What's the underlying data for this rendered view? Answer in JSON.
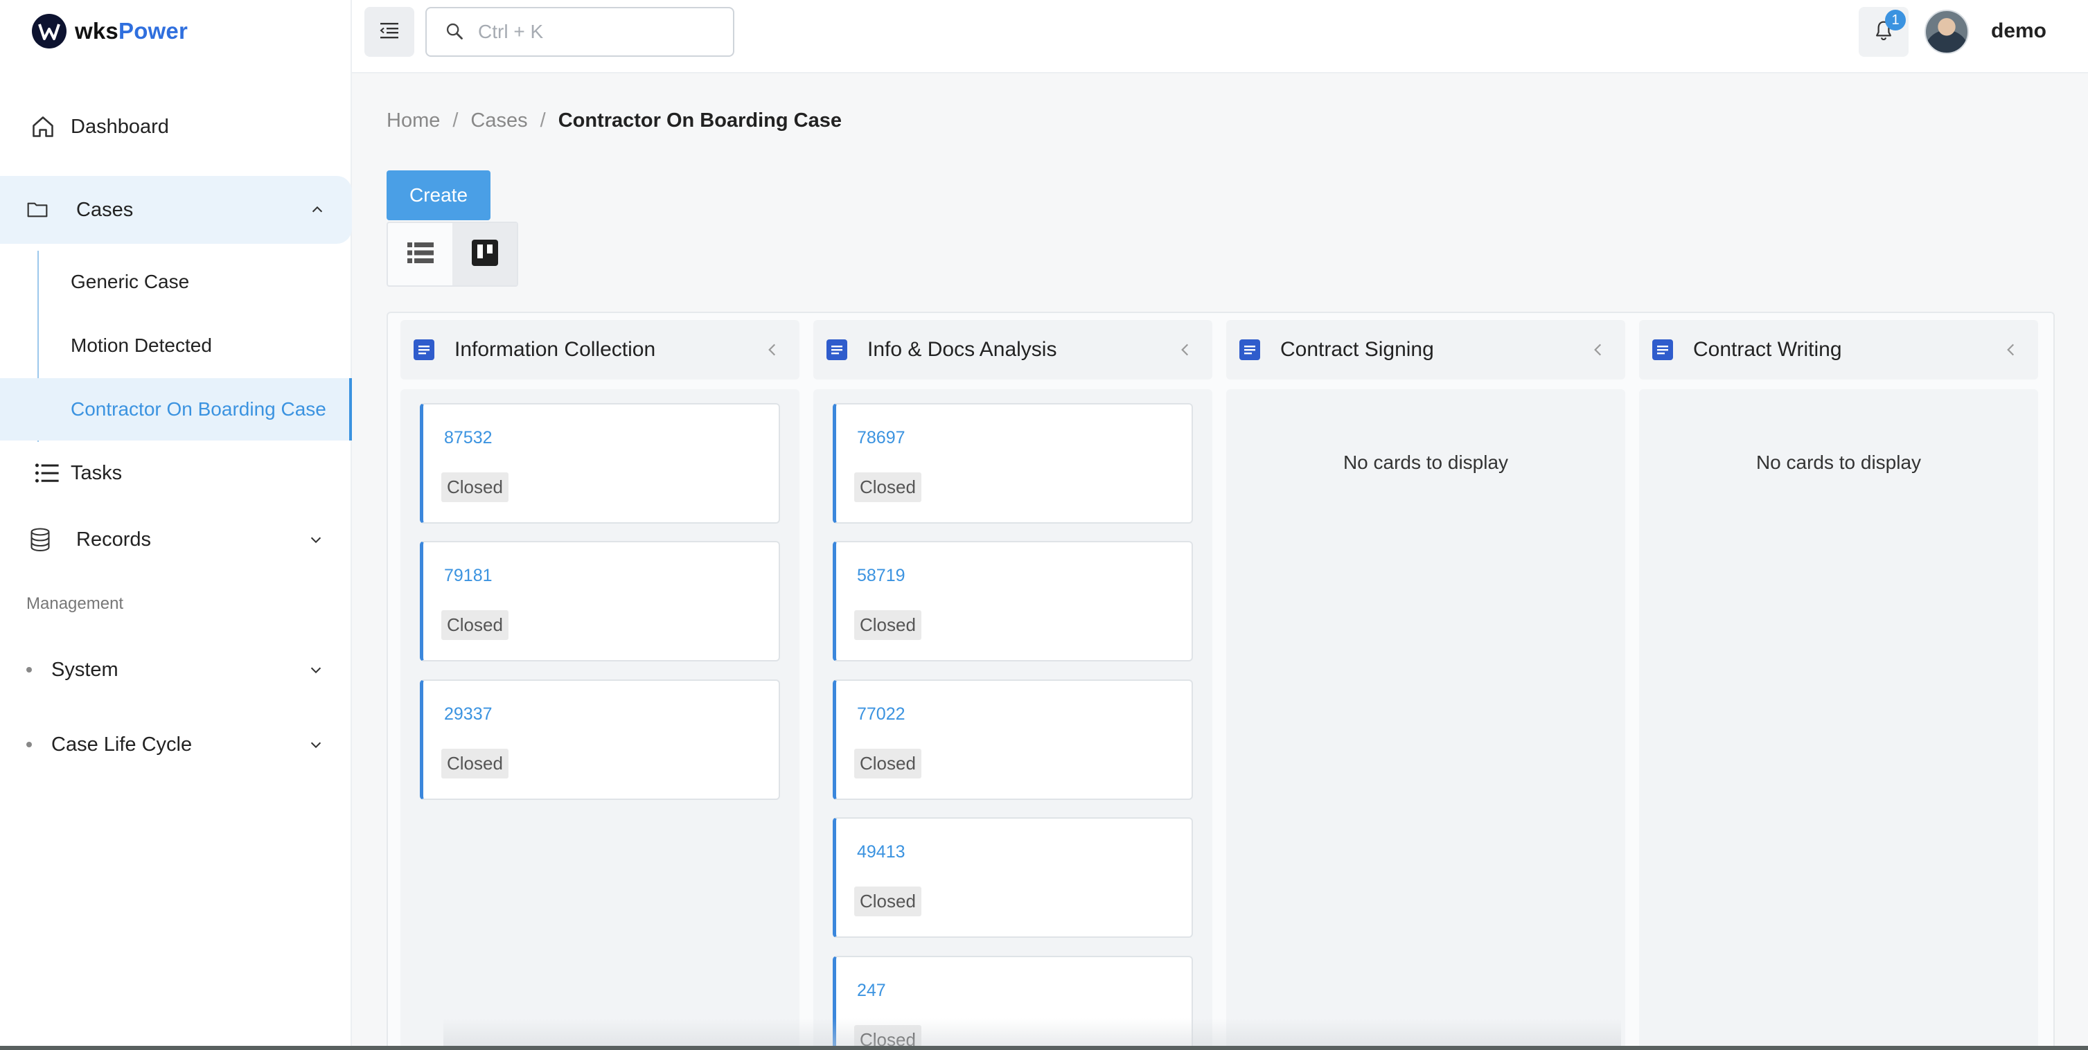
{
  "brand": {
    "name_part1": "wks",
    "name_part2": "Power"
  },
  "sidebar": {
    "dashboard": "Dashboard",
    "cases": "Cases",
    "case_items": [
      "Generic Case",
      "Motion Detected",
      "Contractor On Boarding Case"
    ],
    "tasks": "Tasks",
    "records": "Records",
    "management_label": "Management",
    "system": "System",
    "case_life_cycle": "Case Life Cycle"
  },
  "topbar": {
    "search_placeholder": "Ctrl + K",
    "notification_count": "1",
    "username": "demo"
  },
  "breadcrumb": {
    "home": "Home",
    "cases": "Cases",
    "current": "Contractor On Boarding Case",
    "separator": "/"
  },
  "actions": {
    "create": "Create"
  },
  "board": {
    "empty_text": "No cards to display",
    "columns": [
      {
        "title": "Information Collection",
        "cards": [
          {
            "id": "87532",
            "status": "Closed"
          },
          {
            "id": "79181",
            "status": "Closed"
          },
          {
            "id": "29337",
            "status": "Closed"
          }
        ]
      },
      {
        "title": "Info & Docs Analysis",
        "cards": [
          {
            "id": "78697",
            "status": "Closed"
          },
          {
            "id": "58719",
            "status": "Closed"
          },
          {
            "id": "77022",
            "status": "Closed"
          },
          {
            "id": "49413",
            "status": "Closed"
          },
          {
            "id": "247",
            "status": "Closed"
          }
        ]
      },
      {
        "title": "Contract Signing",
        "cards": []
      },
      {
        "title": "Contract Writing",
        "cards": []
      }
    ]
  },
  "colors": {
    "accent": "#3b93e0",
    "primary_button": "#4a9fe6",
    "active_bg": "#e7f2fb"
  }
}
